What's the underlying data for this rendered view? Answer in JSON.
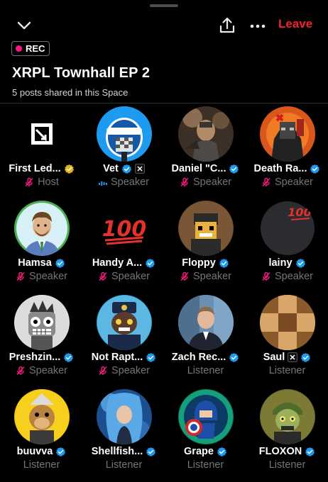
{
  "header": {
    "leave_label": "Leave",
    "rec_label": "REC",
    "title": "XRPL Townhall EP 2",
    "subtitle": "5 posts shared in this Space"
  },
  "colors": {
    "background": "#000000",
    "accent_red": "#f4212e",
    "rec_dot": "#f91880",
    "verified_blue": "#1d9bf0",
    "verified_gold": "#e2b719",
    "muted_text": "#71767b",
    "mic_off": "#f91880"
  },
  "participants": [
    {
      "name": "First Led...",
      "role": "Host",
      "badge": "gold-check",
      "status": "mic-off"
    },
    {
      "name": "Vet",
      "role": "Speaker",
      "badge": "blue-check",
      "extra_badge": "x-affiliate",
      "status": "speaking"
    },
    {
      "name": "Daniel \"C...",
      "role": "Speaker",
      "badge": "blue-check",
      "status": "mic-off"
    },
    {
      "name": "Death Ra...",
      "role": "Speaker",
      "badge": "blue-check",
      "status": "mic-off"
    },
    {
      "name": "Hamsa",
      "role": "Speaker",
      "badge": "blue-check",
      "status": "mic-off"
    },
    {
      "name": "Handy A...",
      "role": "Speaker",
      "badge": "blue-check",
      "status": "mic-off"
    },
    {
      "name": "Floppy",
      "role": "Speaker",
      "badge": "blue-check",
      "status": "mic-off"
    },
    {
      "name": "lainy",
      "role": "Speaker",
      "badge": "blue-check",
      "status": "mic-off"
    },
    {
      "name": "Preshzin...",
      "role": "Speaker",
      "badge": "blue-check",
      "status": "mic-off"
    },
    {
      "name": "Not Rapt...",
      "role": "Speaker",
      "badge": "blue-check",
      "status": "mic-off"
    },
    {
      "name": "Zach Rec...",
      "role": "Listener",
      "badge": "blue-check",
      "status": "none"
    },
    {
      "name": "Saul",
      "role": "Listener",
      "badge": "blue-check",
      "extra_badge": "x-affiliate",
      "status": "none"
    },
    {
      "name": "buuvva",
      "role": "Listener",
      "badge": "blue-check",
      "status": "none"
    },
    {
      "name": "Shellfish...",
      "role": "Listener",
      "badge": "blue-check",
      "status": "none"
    },
    {
      "name": "Grape",
      "role": "Listener",
      "badge": "blue-check",
      "status": "none"
    },
    {
      "name": "FLOXON",
      "role": "Listener",
      "badge": "blue-check",
      "status": "none"
    }
  ],
  "avatar_texts": {
    "handy_emoji": "100",
    "lainy_emoji": "100"
  },
  "icons": {
    "close": "chevron-down-icon",
    "share": "share-upload-icon",
    "more": "more-horizontal-icon",
    "verified": "verified-badge-icon",
    "mic_off": "mic-off-icon",
    "speaking": "audio-bars-icon"
  }
}
